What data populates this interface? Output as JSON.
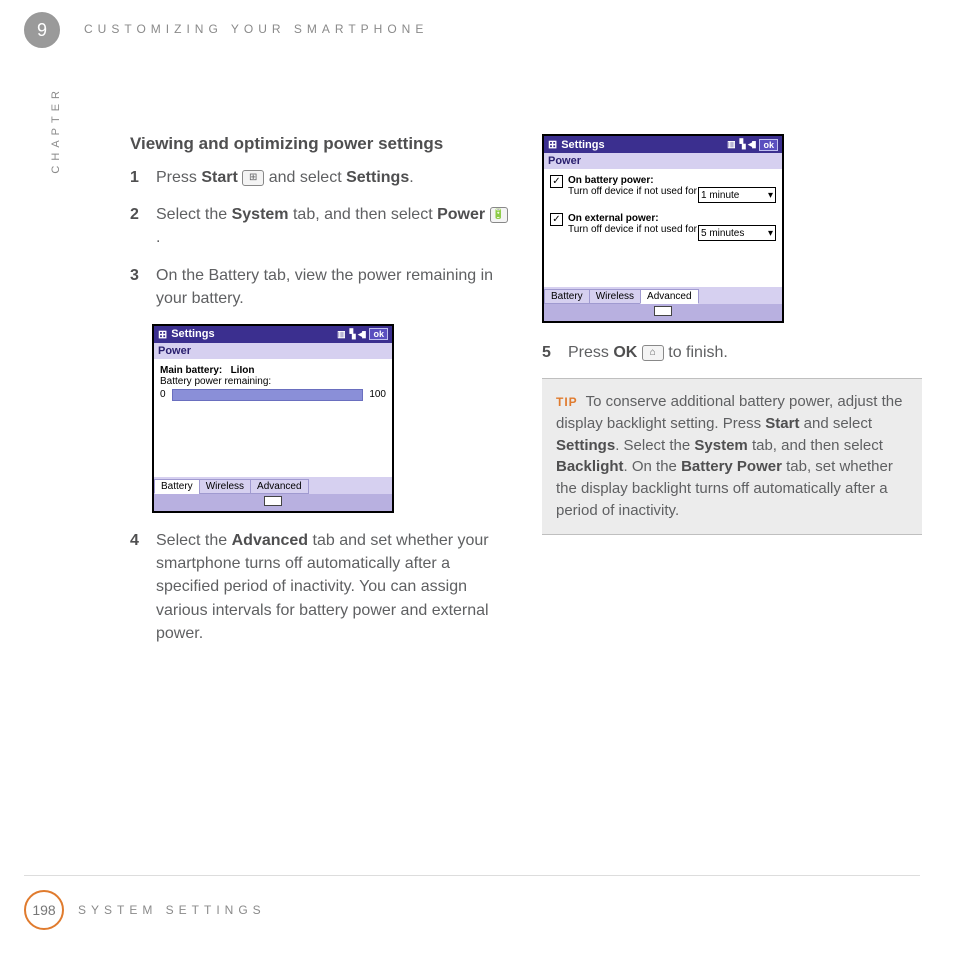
{
  "chapter_number": "9",
  "running_head": "CUSTOMIZING YOUR SMARTPHONE",
  "side_label": "CHAPTER",
  "page_number": "198",
  "footer_label": "SYSTEM SETTINGS",
  "section_title": "Viewing and optimizing power settings",
  "steps": {
    "s1_pre": "Press ",
    "s1_b1": "Start",
    "s1_mid": " and select ",
    "s1_b2": "Settings",
    "s1_post": ".",
    "s2_pre": "Select the ",
    "s2_b1": "System",
    "s2_mid": " tab, and then select ",
    "s2_b2": "Power",
    "s2_post": ".",
    "s3": "On the Battery tab, view the power remaining in your battery.",
    "s4_pre": "Select the ",
    "s4_b1": "Advanced",
    "s4_post": " tab and set whether your smartphone turns off automatically after a specified period of inactivity. You can assign various intervals for battery power and external power.",
    "s5_pre": "Press ",
    "s5_b1": "OK",
    "s5_post": " to finish."
  },
  "device1": {
    "title": "Settings",
    "sub": "Power",
    "main_label": "Main battery:",
    "main_type": "LiIon",
    "remain_label": "Battery power remaining:",
    "zero": "0",
    "hundred": "100",
    "tabs": [
      "Battery",
      "Wireless",
      "Advanced"
    ],
    "ok": "ok"
  },
  "device2": {
    "title": "Settings",
    "sub": "Power",
    "batt_label": "On battery power:",
    "batt_opt": "Turn off device if not used for",
    "batt_val": "1 minute",
    "ext_label": "On external power:",
    "ext_opt": "Turn off device if not used for",
    "ext_val": "5 minutes",
    "tabs": [
      "Battery",
      "Wireless",
      "Advanced"
    ],
    "ok": "ok"
  },
  "tip": {
    "label": "TIP",
    "t1": "To conserve additional battery power, adjust the display backlight setting. Press ",
    "b1": "Start",
    "t2": " and select ",
    "b2": "Settings",
    "t3": ". Select the ",
    "b3": "System",
    "t4": " tab, and then select ",
    "b4": "Backlight",
    "t5": ". On the ",
    "b5": "Battery Power",
    "t6": " tab, set whether the display backlight turns off automatically after a period of inactivity."
  }
}
